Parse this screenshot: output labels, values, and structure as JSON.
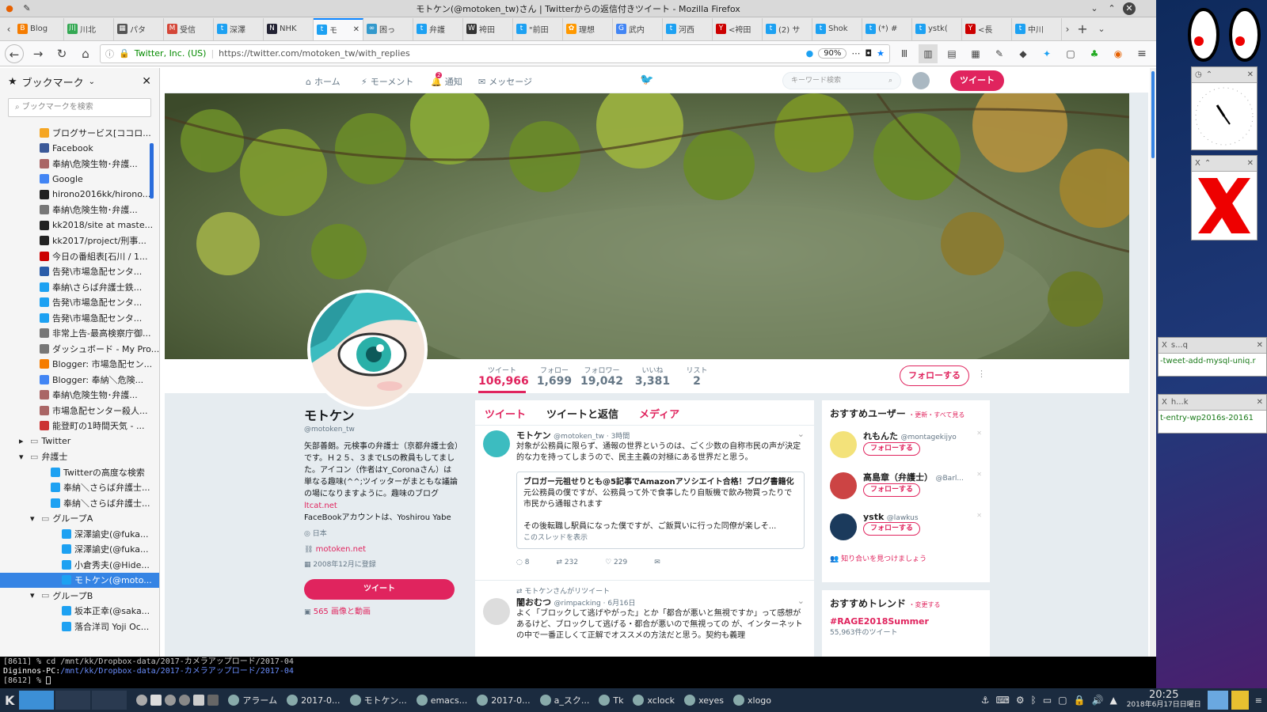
{
  "window": {
    "title": "モトケン(@motoken_tw)さん | Twitterからの返信付きツイート - Mozilla Firefox"
  },
  "tabs": [
    {
      "label": "Blog",
      "color": "#f57c00",
      "glyph": "B"
    },
    {
      "label": "川北",
      "color": "#34a853",
      "glyph": "川"
    },
    {
      "label": "パタ",
      "color": "#555",
      "glyph": "▦"
    },
    {
      "label": "受信",
      "color": "#d44638",
      "glyph": "M"
    },
    {
      "label": "深澤",
      "color": "#1da1f2",
      "glyph": "t"
    },
    {
      "label": "NHK",
      "color": "#223",
      "glyph": "N"
    },
    {
      "label": "モ",
      "color": "#1da1f2",
      "glyph": "t",
      "active": true
    },
    {
      "label": "困っ",
      "color": "#39c",
      "glyph": "∞"
    },
    {
      "label": "弁護",
      "color": "#1da1f2",
      "glyph": "t"
    },
    {
      "label": "袴田",
      "color": "#333",
      "glyph": "W"
    },
    {
      "label": "\"前田",
      "color": "#1da1f2",
      "glyph": "t"
    },
    {
      "label": "理想",
      "color": "#f90",
      "glyph": "✿"
    },
    {
      "label": "武内",
      "color": "#4285f4",
      "glyph": "G"
    },
    {
      "label": "河西",
      "color": "#1da1f2",
      "glyph": "t"
    },
    {
      "label": "<袴田",
      "color": "#c00",
      "glyph": "Y"
    },
    {
      "label": "(2) サ",
      "color": "#1da1f2",
      "glyph": "t"
    },
    {
      "label": "Shok",
      "color": "#1da1f2",
      "glyph": "t"
    },
    {
      "label": "(*) #",
      "color": "#1da1f2",
      "glyph": "t"
    },
    {
      "label": "ystk(",
      "color": "#1da1f2",
      "glyph": "t"
    },
    {
      "label": "<長",
      "color": "#c00",
      "glyph": "Y"
    },
    {
      "label": "中川",
      "color": "#1da1f2",
      "glyph": "t"
    }
  ],
  "navbar": {
    "site_identity": "Twitter, Inc. (US)",
    "url": "https://twitter.com/motoken_tw/with_replies",
    "zoom": "90%"
  },
  "sidebar": {
    "title": "ブックマーク",
    "search_placeholder": "ブックマークを検索",
    "items": [
      {
        "label": "ブログサービス[ココロ...",
        "indent": 1,
        "color": "#f5a623"
      },
      {
        "label": "Facebook",
        "indent": 1,
        "color": "#3b5998"
      },
      {
        "label": "奉納\\危険生物･弁護...",
        "indent": 1,
        "color": "#a66"
      },
      {
        "label": "Google",
        "indent": 1,
        "color": "#4285f4"
      },
      {
        "label": "hirono2016kk/hirono...",
        "indent": 1,
        "color": "#222"
      },
      {
        "label": "奉納\\危険生物･弁護...",
        "indent": 1,
        "color": "#777"
      },
      {
        "label": "kk2018/site at maste...",
        "indent": 1,
        "color": "#222"
      },
      {
        "label": "kk2017/project/刑事...",
        "indent": 1,
        "color": "#222"
      },
      {
        "label": "今日の番組表[石川 / 1...",
        "indent": 1,
        "color": "#c00"
      },
      {
        "label": "告発\\市場急配センタ...",
        "indent": 1,
        "color": "#2a5ca8"
      },
      {
        "label": "奉納\\さらば弁護士鉄...",
        "indent": 1,
        "color": "#1da1f2"
      },
      {
        "label": "告発\\市場急配センタ...",
        "indent": 1,
        "color": "#1da1f2"
      },
      {
        "label": "告発\\市場急配センタ...",
        "indent": 1,
        "color": "#1da1f2"
      },
      {
        "label": "非常上告-最高検察庁御...",
        "indent": 1,
        "color": "#777"
      },
      {
        "label": "ダッシュボード - My Pro...",
        "indent": 1,
        "color": "#777"
      },
      {
        "label": "Blogger: 市場急配セン...",
        "indent": 1,
        "color": "#f57c00"
      },
      {
        "label": "Blogger: 奉納＼危険...",
        "indent": 1,
        "color": "#4285f4"
      },
      {
        "label": "奉納\\危険生物･弁護...",
        "indent": 1,
        "color": "#a66"
      },
      {
        "label": "市場急配センター殺人...",
        "indent": 1,
        "color": "#a66"
      },
      {
        "label": "能登町の1時間天気 - ...",
        "indent": 1,
        "color": "#c33"
      },
      {
        "label": "Twitter",
        "indent": 0,
        "folder": true,
        "arrow": "▸"
      },
      {
        "label": "弁護士",
        "indent": 0,
        "folder": true,
        "arrow": "▾"
      },
      {
        "label": "Twitterの高度な検索",
        "indent": 2,
        "color": "#1da1f2"
      },
      {
        "label": "奉納＼さらば弁護士...",
        "indent": 2,
        "color": "#1da1f2"
      },
      {
        "label": "奉納＼さらば弁護士...",
        "indent": 2,
        "color": "#1da1f2"
      },
      {
        "label": "グループA",
        "indent": 1,
        "folder": true,
        "arrow": "▾"
      },
      {
        "label": "深澤諭史(@fuka...",
        "indent": 3,
        "color": "#1da1f2"
      },
      {
        "label": "深澤諭史(@fuka...",
        "indent": 3,
        "color": "#1da1f2"
      },
      {
        "label": "小倉秀夫(@Hide...",
        "indent": 3,
        "color": "#1da1f2"
      },
      {
        "label": "モトケン(@moto...",
        "indent": 3,
        "color": "#1da1f2",
        "selected": true
      },
      {
        "label": "グループB",
        "indent": 1,
        "folder": true,
        "arrow": "▾"
      },
      {
        "label": "坂本正幸(@saka...",
        "indent": 3,
        "color": "#1da1f2"
      },
      {
        "label": "落合洋司 Yoji Oc...",
        "indent": 3,
        "color": "#1da1f2"
      }
    ]
  },
  "twitter_nav": {
    "home": "ホーム",
    "moments": "モーメント",
    "notifications": "通知",
    "notifications_badge": "2",
    "messages": "メッセージ",
    "search_placeholder": "キーワード検索",
    "tweet_button": "ツイート"
  },
  "stats": [
    {
      "label": "ツイート",
      "value": "106,966",
      "active": true
    },
    {
      "label": "フォロー",
      "value": "1,699"
    },
    {
      "label": "フォロワー",
      "value": "19,042"
    },
    {
      "label": "いいね",
      "value": "3,381"
    },
    {
      "label": "リスト",
      "value": "2"
    }
  ],
  "follow_button": "フォローする",
  "profile": {
    "name": "モトケン",
    "handle": "@motoken_tw",
    "bio": "矢部善朗。元検事の弁護士（京都弁護士会）です。Ｈ２５、３までLSの教員もしてました。アイコン（作者はY_Coronaさん）は単なる趣味(^^;ツイッターがまともな議論の場になりますように。趣味のブログ ",
    "bio_link": "ltcat.net",
    "bio_tail": "FaceBookアカウントは、Yoshirou Yabe",
    "location": "日本",
    "website": "motoken.net",
    "joined": "2008年12月に登録",
    "tweet_button": "ツイート",
    "media_link": "565 画像と動画"
  },
  "timeline": {
    "tabs": [
      "ツイート",
      "ツイートと返信",
      "メディア"
    ],
    "tweet1": {
      "name": "モトケン",
      "handle": "@motoken_tw · 3時間",
      "text": "対象が公務員に限らず、通報の世界というのは、ごく少数の自称市民の声が決定的な力を持ってしまうので、民主主義の対極にある世界だと思う。",
      "quote_title": "ブロガー元祖せりとも@5記事でAmazonアソシエイト合格！ブログ書籍化",
      "quote_text1": "元公務員の僕ですが、公務員って外で食事したり自販機で飲み物買ったりで市民から通報されます",
      "quote_text2": "その後転職し駅員になった僕ですが、ご飯買いに行った同僚が楽しそ...",
      "quote_more": "このスレッドを表示",
      "replies": "8",
      "retweets": "232",
      "likes": "229"
    },
    "retweet_note": "モトケンさんがリツイート",
    "tweet2": {
      "name": "闇おむつ",
      "handle": "@rimpacking · 6月16日",
      "text": "よく「ブロックして逃げやがった」とか「都合が悪いと無視ですか」って感想があるけど、ブロックして逃げる・都合が悪いので無視っての が、インターネットの中で一番正しくて正解でオススメの方法だと思う。契約も義理"
    }
  },
  "who_to_follow": {
    "title": "おすすめユーザー",
    "links": "・更新・すべて見る",
    "users": [
      {
        "name": "れもんた",
        "handle": "@montagekijyo",
        "button": "フォローする",
        "color": "#f3e27a"
      },
      {
        "name": "高島章（弁護士）",
        "handle": "@Barl...",
        "button": "フォローする",
        "color": "#c44"
      },
      {
        "name": "ystk",
        "handle": "@lawkus",
        "button": "フォローする",
        "color": "#1b3a5c"
      }
    ],
    "find_friends": "知り合いを見つけましょう"
  },
  "trends": {
    "title": "おすすめトレンド",
    "change": "・変更する",
    "items": [
      {
        "tag": "#RAGE2018Summer",
        "count": "55,963件のツイート"
      }
    ]
  },
  "terminal": {
    "line1": "[8611]  %  cd /mnt/kk/Dropbox-data/2017-カメラアップロード/2017-04",
    "line2_host": "Diginnos-PC:",
    "line2_path": "/mnt/kk/Dropbox-data/2017-カメラアップロード/2017-04",
    "line3": "[8612]  %"
  },
  "taskbar": {
    "items": [
      {
        "label": "アラーム"
      },
      {
        "label": "2017-0..."
      },
      {
        "label": "モトケン..."
      },
      {
        "label": "emacs..."
      },
      {
        "label": "2017-0..."
      },
      {
        "label": "a_スク..."
      },
      {
        "label": "Tk"
      },
      {
        "label": "xclock"
      },
      {
        "label": "xeyes"
      },
      {
        "label": "xlogo"
      }
    ],
    "time": "20:25",
    "date": "2018年6月17日日曜日"
  },
  "desktop": {
    "snippet1": "-tweet-add-mysql-uniq.r",
    "snippet2": "t-entry-wp2016s-20161",
    "win1_title": "s...q",
    "win2_title": "h...k"
  },
  "colors": {
    "twitter_accent": "#e0245e",
    "twitter_blue": "#1da1f2",
    "ff_accent": "#0a84ff"
  }
}
